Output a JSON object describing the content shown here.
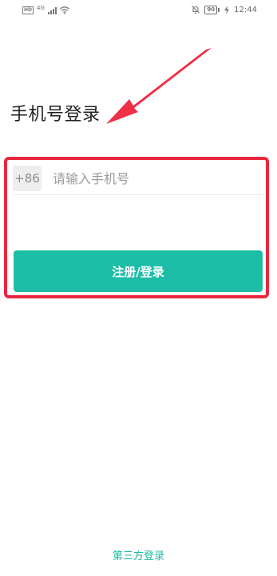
{
  "status_bar": {
    "hd_badge": "HD",
    "network_type": "4G",
    "battery_level": "90",
    "time": "12:44"
  },
  "login": {
    "title": "手机号登录",
    "country_code": "+86",
    "phone_placeholder": "请输入手机号",
    "phone_value": "",
    "submit_label": "注册/登录",
    "third_party_label": "第三方登录"
  },
  "colors": {
    "accent": "#1ebda7",
    "highlight": "#e8283e",
    "link": "#1cb9a4"
  },
  "icons": [
    "signal-icon",
    "wifi-icon",
    "mute-icon",
    "battery-icon",
    "charging-icon",
    "arrow-annotation"
  ]
}
